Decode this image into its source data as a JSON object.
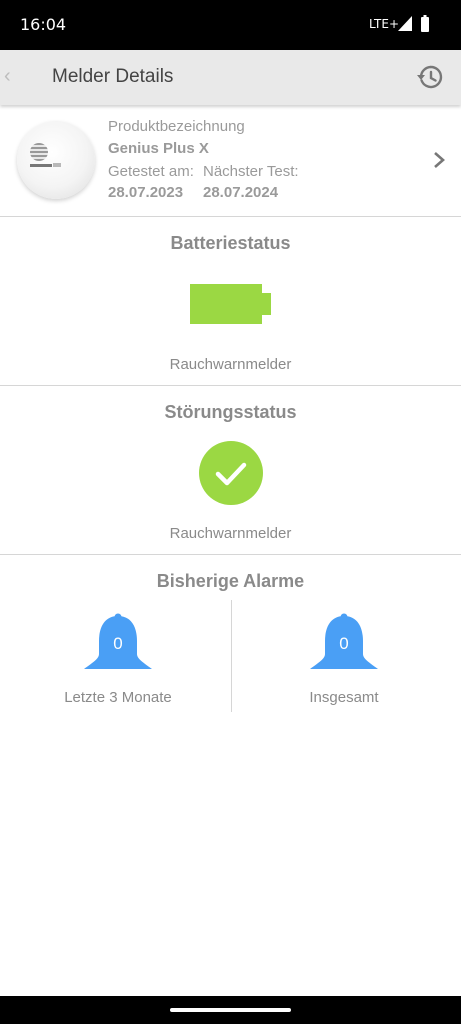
{
  "status_bar": {
    "time": "16:04",
    "network": "LTE+"
  },
  "app_bar": {
    "back_glyph": "‹",
    "title": "Melder Details",
    "history_icon": "history-icon"
  },
  "product": {
    "label": "Produktbezeichnung",
    "name": "Genius Plus X",
    "tested_label": "Getestet am:",
    "next_test_label": "Nächster Test:",
    "tested_date": "28.07.2023",
    "next_test_date": "28.07.2024"
  },
  "battery": {
    "title": "Batteriestatus",
    "subtitle": "Rauchwarnmelder",
    "level": 1.0,
    "color": "#9bd843"
  },
  "fault": {
    "title": "Störungsstatus",
    "subtitle": "Rauchwarnmelder",
    "status": "ok",
    "color": "#9bd843"
  },
  "alarms": {
    "title": "Bisherige Alarme",
    "bell_color": "#4a9ff5",
    "items": [
      {
        "count": "0",
        "label": "Letzte 3 Monate"
      },
      {
        "count": "0",
        "label": "Insgesamt"
      }
    ]
  }
}
